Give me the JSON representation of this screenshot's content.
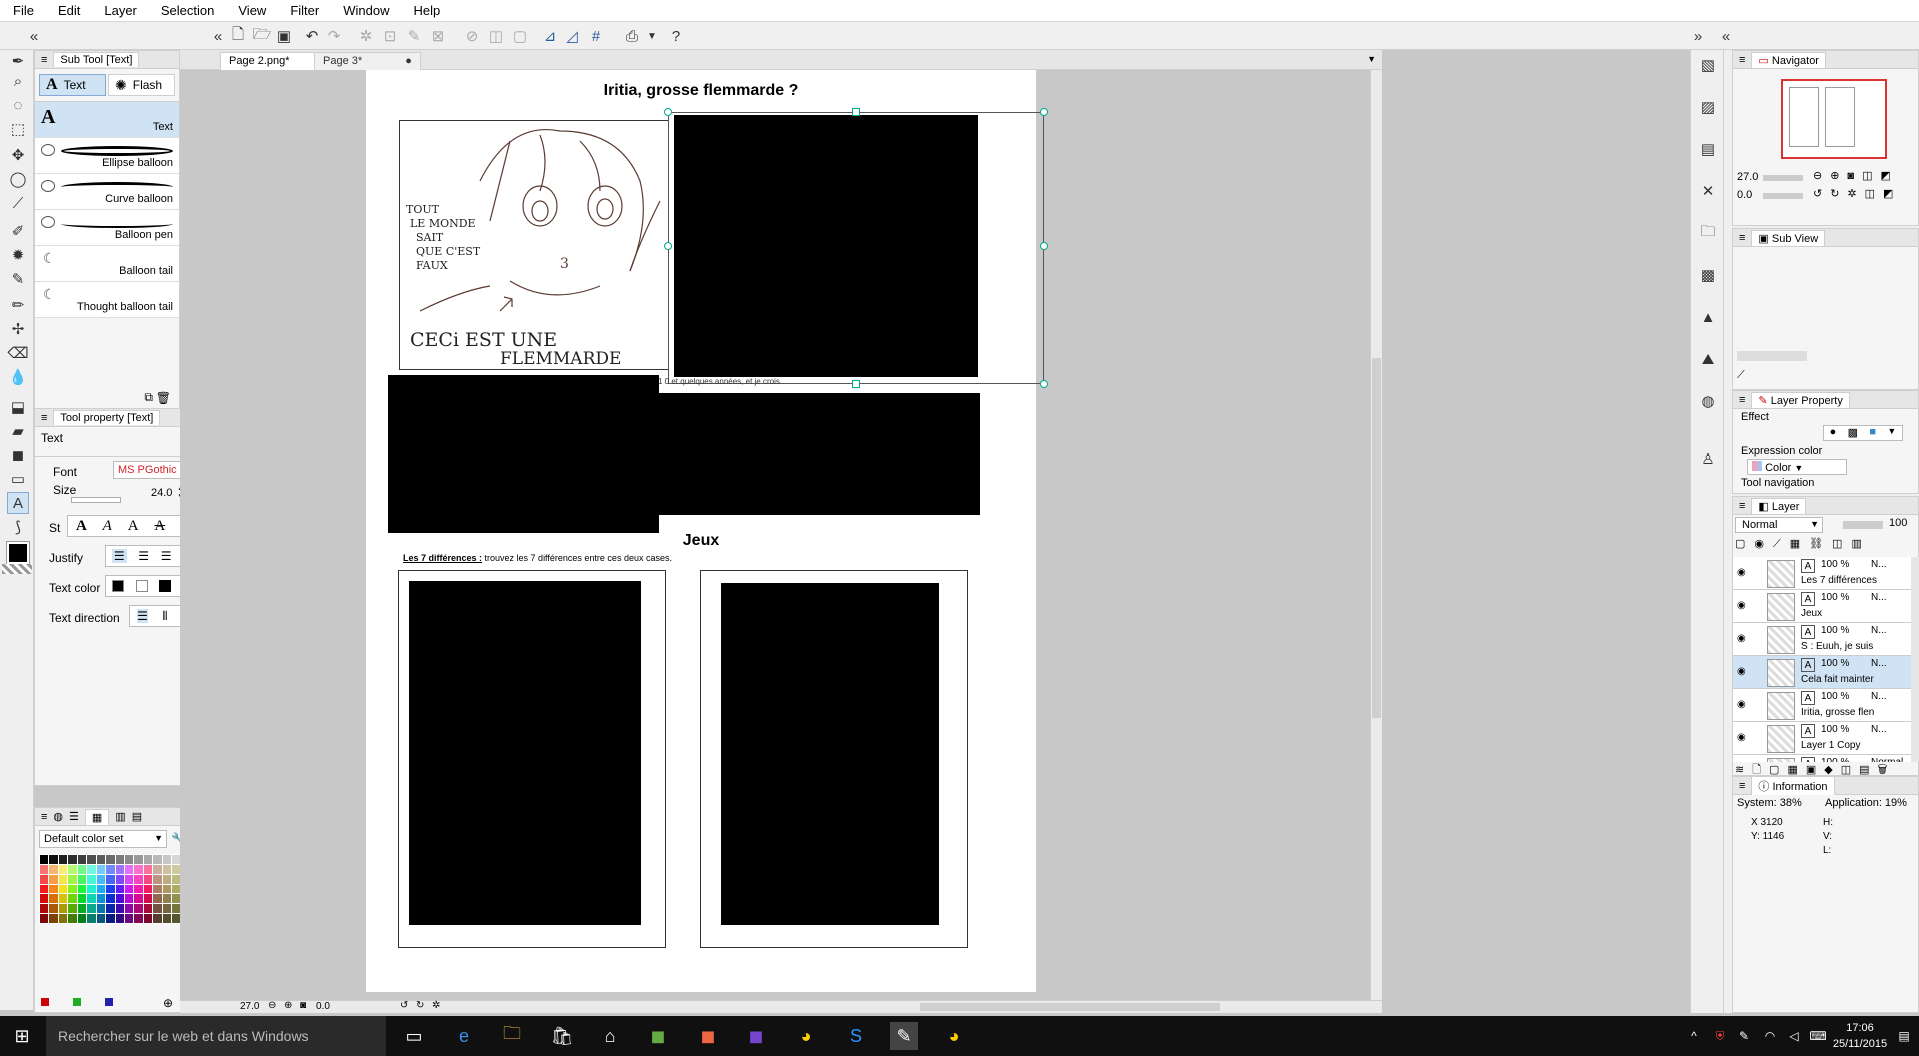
{
  "menu": [
    "File",
    "Edit",
    "Layer",
    "Selection",
    "View",
    "Filter",
    "Window",
    "Help"
  ],
  "subtool": {
    "header": "Sub Tool [Text]",
    "tab_text": "Text",
    "tab_flash": "Flash",
    "items": [
      "Text",
      "Ellipse balloon",
      "Curve balloon",
      "Balloon pen",
      "Balloon tail",
      "Thought balloon tail"
    ]
  },
  "toolprop": {
    "header": "Tool property [Text]",
    "title": "Text",
    "font_label": "Font",
    "font_value": "MS PGothic",
    "size_label": "Size",
    "size_value": "24.0",
    "style_label": "St",
    "justify_label": "Justify",
    "textcolor_label": "Text color",
    "direction_label": "Text direction"
  },
  "colorset": {
    "label": "Default color set"
  },
  "doctabs": [
    "Page 2.png*",
    "Page 3*"
  ],
  "page": {
    "title": "Iritia, grosse flemmarde ?",
    "sketch_lines": [
      "TOUT",
      "LE MONDE",
      "SAIT",
      "QUE C'EST",
      "FAUX"
    ],
    "sketch_bottom": [
      "CECi EST UNE",
      "FLEMMARDE"
    ],
    "sketch_num": "3",
    "caption": "1 0 et quelques années, et je crois",
    "section": "Jeux",
    "diff_bold": "Les 7 différences :",
    "diff_rest": " trouvez les 7 différences entre ces deux cases."
  },
  "navigator": {
    "header": "Navigator",
    "zoom": "27.0",
    "rotate": "0.0"
  },
  "subview": {
    "header": "Sub View"
  },
  "layerprop": {
    "header": "Layer Property",
    "effect": "Effect",
    "expr_label": "Expression color",
    "expr_value": "Color",
    "toolnav": "Tool navigation"
  },
  "layer": {
    "header": "Layer",
    "blend": "Normal",
    "opacity": "100",
    "rows": [
      {
        "pct": "100 %",
        "mode": "N...",
        "name": "Les 7 différences"
      },
      {
        "pct": "100 %",
        "mode": "N...",
        "name": "Jeux"
      },
      {
        "pct": "100 %",
        "mode": "N...",
        "name": "S : Euuh, je suis"
      },
      {
        "pct": "100 %",
        "mode": "N...",
        "name": "Cela fait mainter"
      },
      {
        "pct": "100 %",
        "mode": "N...",
        "name": "Iritia, grosse flen"
      },
      {
        "pct": "100 %",
        "mode": "N...",
        "name": "Layer 1 Copy"
      },
      {
        "pct": "100 %",
        "mode": "Normal",
        "name": ""
      }
    ]
  },
  "info": {
    "header": "Information",
    "system": "System: 38%",
    "app": "Application: 19%",
    "x": "X 3120",
    "y": "Y: 1146",
    "h": "H:",
    "v": "V:",
    "l": "L:"
  },
  "statusbar": {
    "zoom": "27.0",
    "rotate": "0.0"
  },
  "taskbar": {
    "search": "Rechercher sur le web et dans Windows",
    "time": "17:06",
    "date": "25/11/2015"
  }
}
